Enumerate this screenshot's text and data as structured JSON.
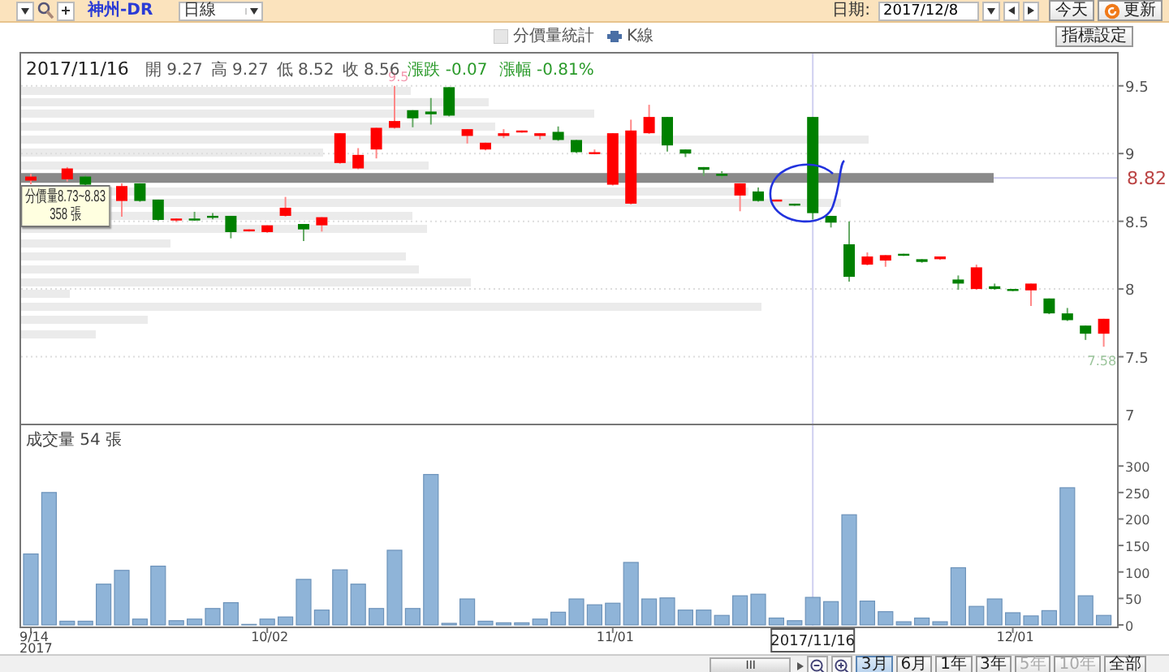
{
  "toolbar": {
    "symbol": "神州-DR",
    "period": "日線",
    "date_label": "日期:",
    "date": "2017/12/8",
    "today_button": "今天",
    "refresh_button": "更新"
  },
  "legend": {
    "items": [
      {
        "kind": "histogram",
        "label": "分價量統計"
      },
      {
        "kind": "kline",
        "label": "K線"
      }
    ],
    "settings_button": "指標設定"
  },
  "price_panel": {
    "date": "2017/11/16",
    "quote": [
      {
        "kind": "price",
        "text": "開 9.27"
      },
      {
        "kind": "price",
        "text": "高 9.27"
      },
      {
        "kind": "price",
        "text": "低 8.52"
      },
      {
        "kind": "price",
        "text": "收 8.56"
      },
      {
        "kind": "change",
        "text": "漲跌 -0.07"
      },
      {
        "kind": "change",
        "text": "漲幅 -0.81%"
      }
    ],
    "tooltip": {
      "range": "分價量8.73~8.83",
      "volume": "358 張"
    },
    "crosshair_price": "8.82",
    "chart_data": {
      "type": "candlestick",
      "grid": true,
      "yticks": [
        7,
        7.5,
        8,
        8.5,
        9,
        9.5
      ],
      "ylim": [
        7,
        9.75
      ],
      "categories": [
        null,
        null,
        null,
        null,
        null,
        null,
        null,
        null,
        null,
        null,
        null,
        null,
        null,
        null,
        null,
        null,
        null,
        null,
        null,
        null,
        null,
        null,
        null,
        null,
        null,
        null,
        null,
        null,
        null,
        null,
        null,
        null,
        null,
        null,
        null,
        null,
        null,
        null,
        null,
        null,
        null,
        null,
        null,
        null,
        null,
        null,
        null,
        null,
        null,
        null,
        null,
        null,
        null,
        null,
        null,
        null,
        null,
        null,
        null,
        null
      ],
      "ohlc": [
        [
          8.8,
          8.85,
          8.78,
          8.83
        ],
        null,
        [
          8.81,
          8.9,
          8.8,
          8.89
        ],
        [
          8.83,
          8.84,
          8.77,
          8.77
        ],
        null,
        [
          8.65,
          8.78,
          8.54,
          8.76
        ],
        [
          8.78,
          8.78,
          8.65,
          8.65
        ],
        [
          8.66,
          8.66,
          8.51,
          8.51
        ],
        [
          8.51,
          8.52,
          8.5,
          8.52
        ],
        [
          8.52,
          8.57,
          8.51,
          8.51
        ],
        [
          8.54,
          8.56,
          8.52,
          8.53
        ],
        [
          8.54,
          8.54,
          8.38,
          8.42
        ],
        [
          8.43,
          8.44,
          8.43,
          8.44
        ],
        [
          8.42,
          8.47,
          8.42,
          8.47
        ],
        [
          8.54,
          8.68,
          8.54,
          8.6
        ],
        [
          8.48,
          8.48,
          8.36,
          8.44
        ],
        [
          8.47,
          8.53,
          8.43,
          8.53
        ],
        [
          8.93,
          9.15,
          8.93,
          9.15
        ],
        [
          8.89,
          9.04,
          8.89,
          8.99
        ],
        [
          9.03,
          9.19,
          8.97,
          9.19
        ],
        [
          9.19,
          9.5,
          9.19,
          9.24
        ],
        [
          9.32,
          9.32,
          9.2,
          9.26
        ],
        [
          9.31,
          9.41,
          9.22,
          9.29
        ],
        [
          9.49,
          9.49,
          9.28,
          9.28
        ],
        [
          9.13,
          9.18,
          9.08,
          9.18
        ],
        [
          9.03,
          9.08,
          9.03,
          9.08
        ],
        [
          9.13,
          9.18,
          9.12,
          9.15
        ],
        [
          9.16,
          9.17,
          9.16,
          9.17
        ],
        [
          9.13,
          9.15,
          9.11,
          9.15
        ],
        [
          9.16,
          9.2,
          9.1,
          9.1
        ],
        [
          9.1,
          9.1,
          9.01,
          9.01
        ],
        [
          9.0,
          9.03,
          9.0,
          9.01
        ],
        [
          8.77,
          9.15,
          8.77,
          9.15
        ],
        [
          8.63,
          9.25,
          8.63,
          9.17
        ],
        [
          9.15,
          9.36,
          9.15,
          9.27
        ],
        [
          9.27,
          9.27,
          9.02,
          9.06
        ],
        [
          9.03,
          9.03,
          8.98,
          9.0
        ],
        [
          8.9,
          8.9,
          8.84,
          8.88
        ],
        [
          8.85,
          8.87,
          8.82,
          8.84
        ],
        [
          8.69,
          8.78,
          8.58,
          8.78
        ],
        [
          8.72,
          8.75,
          8.65,
          8.65
        ],
        [
          8.66,
          8.66,
          8.66,
          8.66
        ],
        [
          8.63,
          8.63,
          8.62,
          8.62
        ],
        [
          9.27,
          9.27,
          8.52,
          8.56
        ],
        [
          8.54,
          8.54,
          8.46,
          8.49
        ],
        [
          8.33,
          8.5,
          8.06,
          8.09
        ],
        [
          8.18,
          8.27,
          8.18,
          8.24
        ],
        [
          8.21,
          8.25,
          8.17,
          8.25
        ],
        [
          8.26,
          8.26,
          8.25,
          8.25
        ],
        [
          8.22,
          8.22,
          8.2,
          8.2
        ],
        [
          8.22,
          8.24,
          8.22,
          8.24
        ],
        [
          8.07,
          8.1,
          8.0,
          8.04
        ],
        [
          8.0,
          8.18,
          8.0,
          8.16
        ],
        [
          8.02,
          8.04,
          8.0,
          8.0
        ],
        [
          8.0,
          8.0,
          7.99,
          7.99
        ],
        [
          7.99,
          8.04,
          7.88,
          8.04
        ],
        [
          7.93,
          7.93,
          7.82,
          7.82
        ],
        [
          7.82,
          7.86,
          7.77,
          7.77
        ],
        [
          7.73,
          7.73,
          7.63,
          7.67
        ],
        [
          7.67,
          7.78,
          7.58,
          7.78
        ]
      ],
      "annotations": [
        "9.5",
        "7.58"
      ]
    }
  },
  "volume_panel": {
    "title": "成交量 54 張",
    "crosshair_date": "2017/11/16",
    "year_label": "2017",
    "chart_data": {
      "type": "bar",
      "yticks": [
        0,
        50,
        100,
        150,
        200,
        250,
        300
      ],
      "ylim": [
        0,
        380
      ],
      "categories": [
        "9/14",
        null,
        null,
        null,
        null,
        null,
        null,
        null,
        null,
        null,
        null,
        null,
        null,
        "10/02",
        null,
        null,
        null,
        null,
        null,
        null,
        null,
        null,
        null,
        null,
        null,
        null,
        null,
        null,
        null,
        null,
        null,
        null,
        "11/01",
        null,
        null,
        null,
        null,
        null,
        null,
        null,
        null,
        null,
        null,
        null,
        null,
        null,
        null,
        null,
        null,
        null,
        null,
        null,
        null,
        null,
        "12/01",
        null,
        null,
        null,
        null,
        null
      ],
      "values": [
        134,
        250,
        7,
        7,
        77,
        103,
        11,
        111,
        8,
        11,
        31,
        42,
        1,
        11,
        15,
        86,
        28,
        104,
        77,
        31,
        141,
        31,
        284,
        3,
        49,
        7,
        4,
        4,
        11,
        24,
        49,
        38,
        41,
        118,
        49,
        51,
        28,
        28,
        18,
        55,
        58,
        13,
        8,
        52,
        44,
        208,
        45,
        25,
        6,
        13,
        6,
        108,
        35,
        49,
        23,
        17,
        27,
        259,
        55,
        18
      ]
    }
  },
  "range_buttons": [
    {
      "label": "3月",
      "selected": true,
      "disabled": false
    },
    {
      "label": "6月",
      "selected": false,
      "disabled": false
    },
    {
      "label": "1年",
      "selected": false,
      "disabled": false
    },
    {
      "label": "3年",
      "selected": false,
      "disabled": false
    },
    {
      "label": "5年",
      "selected": false,
      "disabled": true
    },
    {
      "label": "10年",
      "selected": false,
      "disabled": true
    },
    {
      "label": "全部",
      "selected": false,
      "disabled": false
    }
  ],
  "scrollbar_grip": "III"
}
